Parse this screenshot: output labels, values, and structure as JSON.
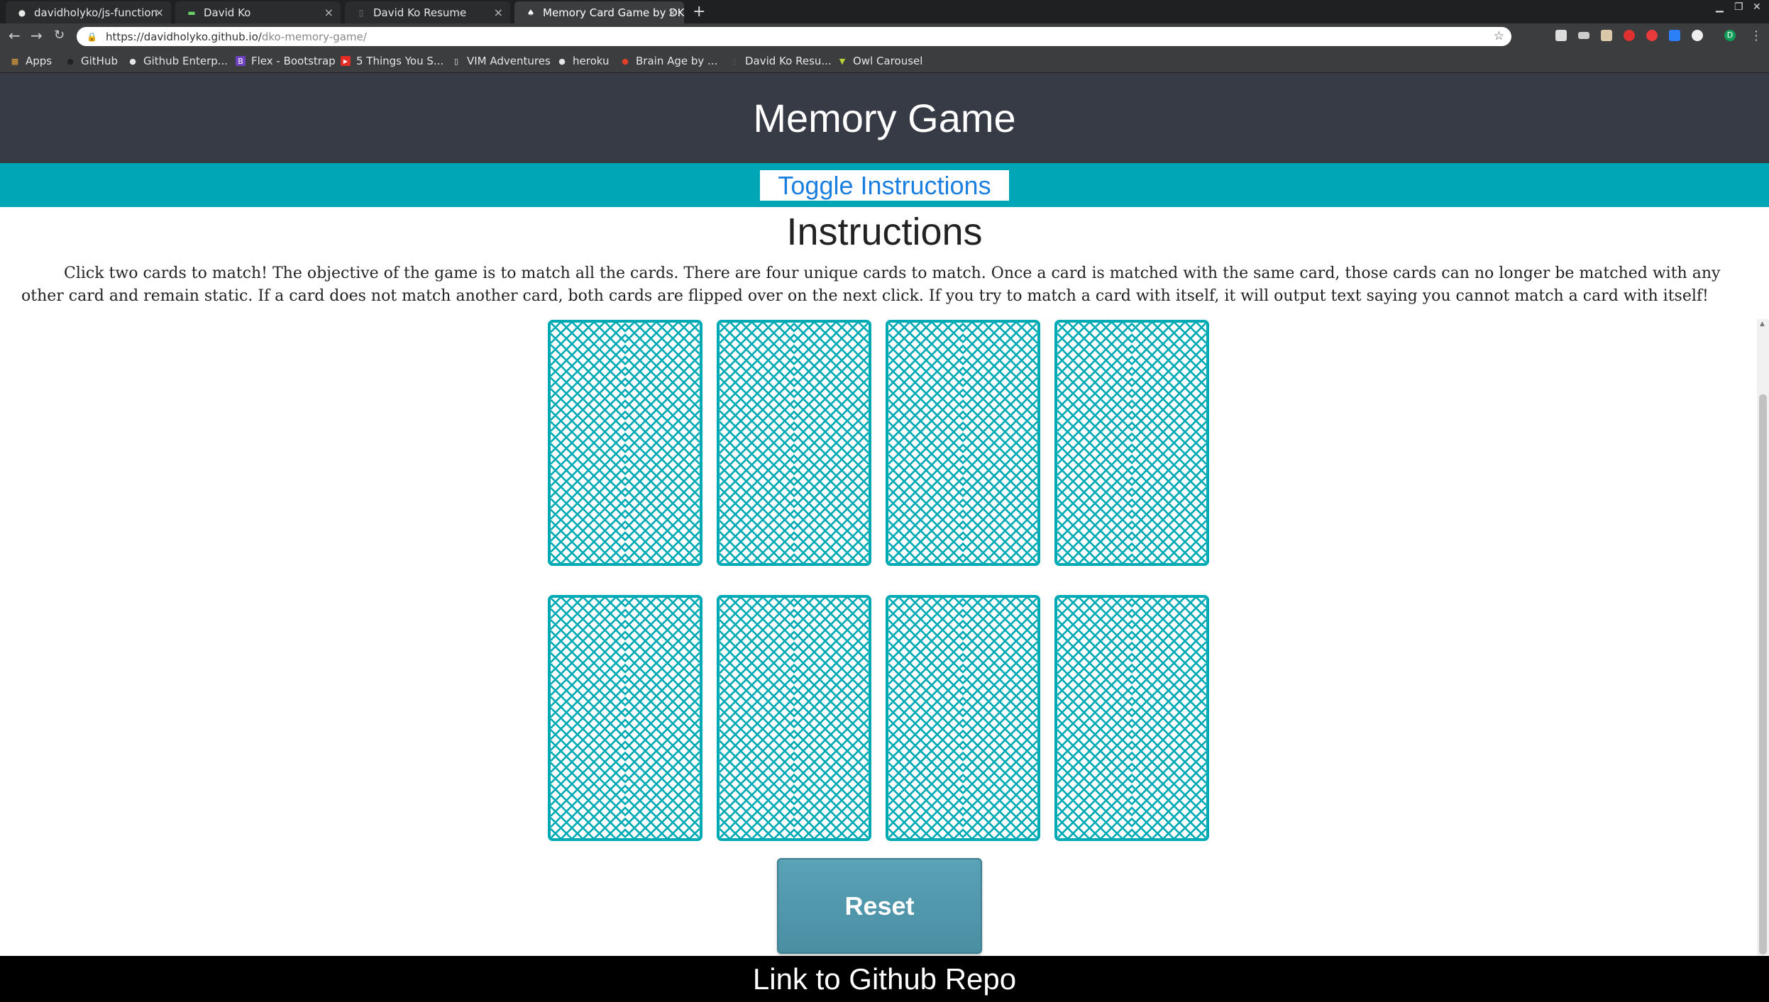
{
  "browser": {
    "tabs": [
      {
        "title": "davidholyko/js-function-",
        "icon": "github-icon",
        "active": false
      },
      {
        "title": "David Ko",
        "icon": "site-icon",
        "active": false
      },
      {
        "title": "David Ko Resume",
        "icon": "doc-icon",
        "active": false
      },
      {
        "title": "Memory Card Game by DK",
        "icon": "spade-icon",
        "active": true
      }
    ],
    "url": {
      "host": "https://davidholyko.github.io/",
      "path": "dko-memory-game/"
    },
    "bookmarks": [
      {
        "label": "Apps",
        "icon": "apps-grid-icon"
      },
      {
        "label": "GitHub",
        "icon": "github-icon"
      },
      {
        "label": "Github Enterp...",
        "icon": "github-icon"
      },
      {
        "label": "Flex - Bootstrap",
        "icon": "bootstrap-icon"
      },
      {
        "label": "5 Things You S...",
        "icon": "youtube-icon"
      },
      {
        "label": "VIM Adventures",
        "icon": "page-icon"
      },
      {
        "label": "heroku",
        "icon": "github-icon"
      },
      {
        "label": "Brain Age by ...",
        "icon": "brain-icon"
      },
      {
        "label": "David Ko Resu...",
        "icon": "doc-icon"
      },
      {
        "label": "Owl Carousel",
        "icon": "owl-icon"
      }
    ],
    "profile_initial": "D"
  },
  "page": {
    "title": "Memory Game",
    "toggle_label": "Toggle Instructions",
    "instructions_heading": "Instructions",
    "instructions_text": "Click two cards to match! The objective of the game is to match all the cards. There are four unique cards to match. Once a card is matched with the same card, those cards can no longer be matched with any other card and remain static. If a card does not match another card, both cards are flipped over on the next click. If you try to match a card with itself, it will output text saying you cannot match a card with itself!",
    "reset_label": "Reset",
    "footer_link": "Link to Github Repo",
    "card_count": 8
  },
  "colors": {
    "header_bg": "#373b45",
    "teal": "#00a6b5",
    "card_stroke": "#00aab5",
    "reset_bg": "#4f96aa"
  }
}
